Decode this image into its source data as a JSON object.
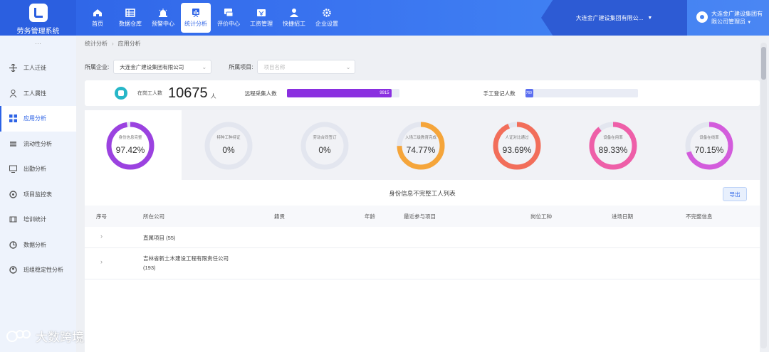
{
  "app": {
    "title": "劳务管理系统"
  },
  "nav": [
    {
      "label": "首页",
      "icon": "home-icon"
    },
    {
      "label": "数据仓库",
      "icon": "database-icon"
    },
    {
      "label": "预警中心",
      "icon": "alarm-icon"
    },
    {
      "label": "统计分析",
      "icon": "stats-icon",
      "active": true
    },
    {
      "label": "评价中心",
      "icon": "review-icon"
    },
    {
      "label": "工资管理",
      "icon": "wage-icon"
    },
    {
      "label": "快捷招工",
      "icon": "recruit-icon"
    },
    {
      "label": "企业设置",
      "icon": "settings-icon"
    }
  ],
  "header": {
    "org": "大连金广建设集团有限公...",
    "user_line1": "大连金广建设集团有",
    "user_line2": "限公司管理员"
  },
  "sidebar": {
    "collapse": "···",
    "items": [
      {
        "label": "工人迁徙",
        "icon": "migration-icon"
      },
      {
        "label": "工人属性",
        "icon": "worker-attr-icon"
      },
      {
        "label": "应用分析",
        "icon": "app-analysis-icon",
        "active": true
      },
      {
        "label": "流动性分析",
        "icon": "flow-icon"
      },
      {
        "label": "出勤分析",
        "icon": "attendance-icon"
      },
      {
        "label": "项目监控表",
        "icon": "project-monitor-icon"
      },
      {
        "label": "培训统计",
        "icon": "training-icon"
      },
      {
        "label": "数据分析",
        "icon": "data-analysis-icon"
      },
      {
        "label": "班组稳定性分析",
        "icon": "team-stability-icon"
      }
    ]
  },
  "breadcrumb": [
    "统计分析",
    "应用分析"
  ],
  "filters": {
    "company_label": "所属企业:",
    "company_value": "大连金广建设集团有限公司",
    "project_label": "所属项目:",
    "project_placeholder": "项目名称"
  },
  "stats": {
    "total_label": "在岗工人数",
    "total_value": "10675",
    "total_unit": "人",
    "auto_label": "远程采集人数",
    "auto_value": "9915",
    "auto_fraction": 0.93,
    "manual_label": "手工登记人数",
    "manual_value": "760",
    "manual_fraction": 0.07
  },
  "rings": [
    {
      "label": "身份信息完整",
      "value": "97.42%",
      "pct": 97.42,
      "color": "#9b42e0"
    },
    {
      "label": "特种工种持证",
      "value": "0%",
      "pct": 0,
      "color": "#d9dce8"
    },
    {
      "label": "劳动合同签订",
      "value": "0%",
      "pct": 0,
      "color": "#d9dce8"
    },
    {
      "label": "入场三级教育完成",
      "value": "74.77%",
      "pct": 74.77,
      "color": "#f5a53a"
    },
    {
      "label": "人证对比通过",
      "value": "93.69%",
      "pct": 93.69,
      "color": "#f26e5a"
    },
    {
      "label": "设备在用率",
      "value": "89.33%",
      "pct": 89.33,
      "color": "#ee5fa8"
    },
    {
      "label": "设备在线率",
      "value": "70.15%",
      "pct": 70.15,
      "color": "#d35cdc"
    }
  ],
  "list": {
    "title": "身份信息不完整工人列表",
    "export": "导出",
    "columns": [
      "序号",
      "所在公司",
      "籍贯",
      "年龄",
      "最近参与项目",
      "岗位工种",
      "进场日期",
      "不完整信息"
    ],
    "rows": [
      {
        "text": "直属项目 (55)"
      },
      {
        "text": "吉林省新土木建设工程有限责任公司",
        "text2": "(193)"
      }
    ]
  },
  "watermark": "大数跨境"
}
